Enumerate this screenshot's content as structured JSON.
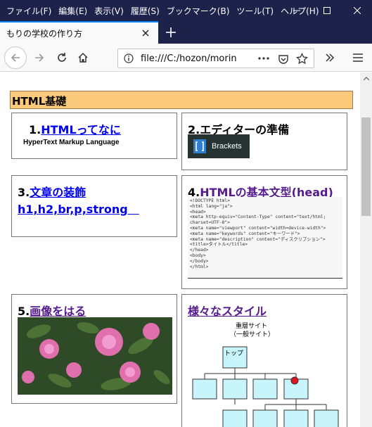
{
  "menubar": {
    "items": [
      "ファイル(F)",
      "編集(E)",
      "表示(V)",
      "履歴(S)",
      "ブックマーク(B)",
      "ツール(T)",
      "ヘルプ(H)"
    ]
  },
  "tab": {
    "title": "もりの学校の作り方"
  },
  "navbar": {
    "url": "file:///C:/hozon/morin"
  },
  "page": {
    "heading": "HTML基礎",
    "cards": {
      "c1": {
        "number": "1.",
        "link": "HTMLってなに",
        "subtitle": "HyperText Markup Language"
      },
      "c2": {
        "title": "2.エディターの準備",
        "brackets_label": "Brackets"
      },
      "c3": {
        "number": "3.",
        "link_line1": "文章の装飾",
        "link_line2": "h1,h2,br,p,strong　"
      },
      "c4": {
        "number": "4.",
        "link": "HTMLの基本文型(head)",
        "code_lines": [
          "<!DOCTYPE html>",
          "<html lang=\"ja\">",
          "<head>",
          "<meta http-equiv=\"Content-Type\" content=\"text/html;",
          "charset=UTF-8\">",
          "<meta name=\"viewport\" content=\"width=device-width\">",
          "<meta name=\"keywords\" content=\"キーワード\">",
          "<meta name=\"description\" content=\"ディスクリプション\">",
          "<title>タイトル</title>",
          "</head>",
          "<body>",
          "</body>",
          "</html>"
        ]
      },
      "c5": {
        "number": "5.",
        "link": "画像をはる"
      },
      "c6": {
        "link": "様々なスタイル",
        "diagram_label_1": "重層サイト",
        "diagram_label_2": "（一般サイト）",
        "diagram_top": "トップ"
      }
    }
  },
  "colors": {
    "heading_bg": "#fbc97b",
    "titlebar": "#1c2249",
    "link": "#0000ee",
    "visited": "#551a8b"
  }
}
